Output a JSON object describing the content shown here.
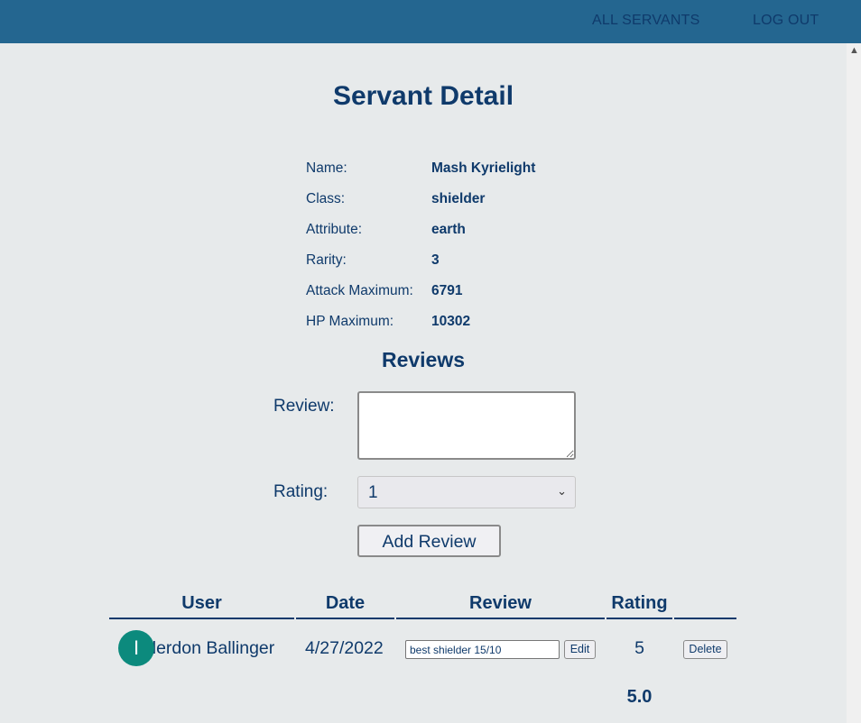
{
  "nav": {
    "all_servants": "ALL SERVANTS",
    "log_out": "LOG OUT"
  },
  "page_title": "Servant Detail",
  "details": [
    {
      "label": "Name:",
      "value": "Mash Kyrielight"
    },
    {
      "label": "Class:",
      "value": "shielder"
    },
    {
      "label": "Attribute:",
      "value": "earth"
    },
    {
      "label": "Rarity:",
      "value": "3"
    },
    {
      "label": "Attack Maximum:",
      "value": "6791"
    },
    {
      "label": "HP Maximum:",
      "value": "10302"
    }
  ],
  "reviews_heading": "Reviews",
  "form": {
    "review_label": "Review:",
    "review_value": "",
    "rating_label": "Rating:",
    "rating_selected": "1",
    "add_button": "Add Review"
  },
  "table": {
    "headers": [
      "User",
      "Date",
      "Review",
      "Rating",
      ""
    ],
    "rows": [
      {
        "avatar_initial": "I",
        "user": "Illerdon Ballinger",
        "date": "4/27/2022",
        "review": "best shielder 15/10",
        "edit_label": "Edit",
        "rating": "5",
        "delete_label": "Delete"
      }
    ],
    "average_rating": "5.0"
  },
  "colors": {
    "topbar": "#246690",
    "text": "#0f3a6b",
    "avatar": "#0c8a7d",
    "background": "#e7eaeb"
  },
  "icons": {
    "scroll_up": "chevron-up-icon",
    "select": "chevron-down-icon"
  }
}
